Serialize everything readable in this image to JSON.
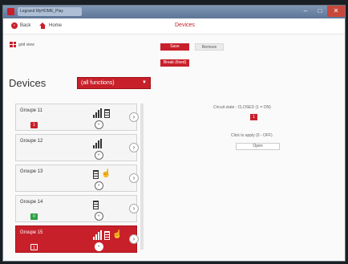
{
  "window": {
    "tab_title": "Legrand MyHOME_Play",
    "min_label": "–",
    "max_label": "□",
    "close_label": "✕"
  },
  "nav": {
    "back_label": "Back",
    "home_label": "Home",
    "title": "Devices"
  },
  "toolbar": {
    "grid_label": "grid view",
    "save_label": "Save",
    "remove_label": "Remove",
    "break_label": "Break (fixed)"
  },
  "sidebar": {
    "title": "Devices",
    "filter_value": "(all functions)"
  },
  "groups": [
    {
      "label": "Groupe 11",
      "badge": "1",
      "badge_color": "#c8202a",
      "icons": [
        "bars-icon",
        "blind-icon"
      ],
      "selected": false
    },
    {
      "label": "Groupe 12",
      "badge": "",
      "badge_color": "",
      "icons": [
        "bars-icon"
      ],
      "selected": false
    },
    {
      "label": "Groupe 13",
      "badge": "",
      "badge_color": "",
      "icons": [
        "blind-icon",
        "hand-icon"
      ],
      "selected": false
    },
    {
      "label": "Groupe 14",
      "badge": "0",
      "badge_color": "#2ea043",
      "icons": [
        "blind-icon"
      ],
      "selected": false
    },
    {
      "label": "Groupe 15",
      "badge": "1",
      "badge_color": "#c8202a",
      "icons": [
        "bars-icon",
        "blind-icon",
        "hand-icon"
      ],
      "selected": true
    }
  ],
  "detail": {
    "state_label": "Circuit state : CLOSED (1 = ON)",
    "state_value": "1",
    "command_label": "Click to apply (0 - OFF)",
    "command_value": "Open"
  },
  "colors": {
    "accent": "#c8202a",
    "green": "#2ea043"
  }
}
